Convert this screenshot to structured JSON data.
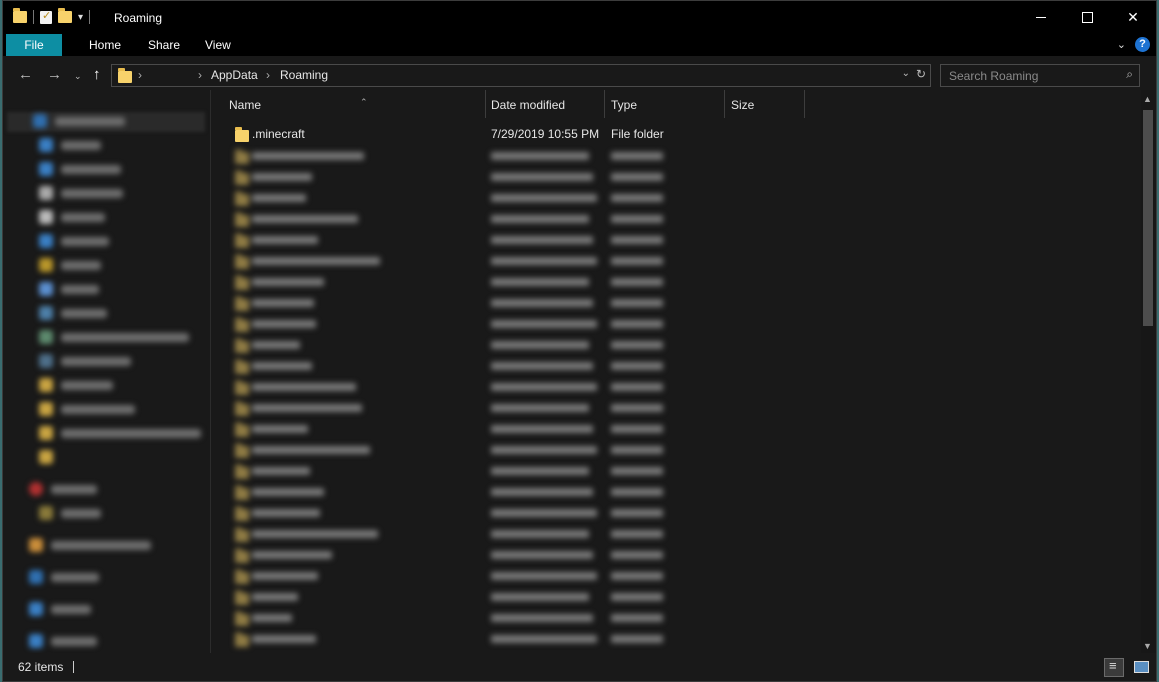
{
  "window": {
    "title": "Roaming"
  },
  "ribbon": {
    "tabs": [
      "File",
      "Home",
      "Share",
      "View"
    ]
  },
  "address": {
    "crumbs": [
      "AppData",
      "Roaming"
    ]
  },
  "search": {
    "placeholder": "Search Roaming"
  },
  "columns": {
    "name": "Name",
    "date": "Date modified",
    "type": "Type",
    "size": "Size"
  },
  "files": [
    {
      "name": ".minecraft",
      "date": "7/29/2019 10:55 PM",
      "type": "File folder"
    }
  ],
  "status": {
    "item_count": "62 items"
  },
  "colors": {
    "accent": "#0d8ea3",
    "folder": "#f7d26b",
    "background": "#191919",
    "titlebar": "#000000"
  }
}
